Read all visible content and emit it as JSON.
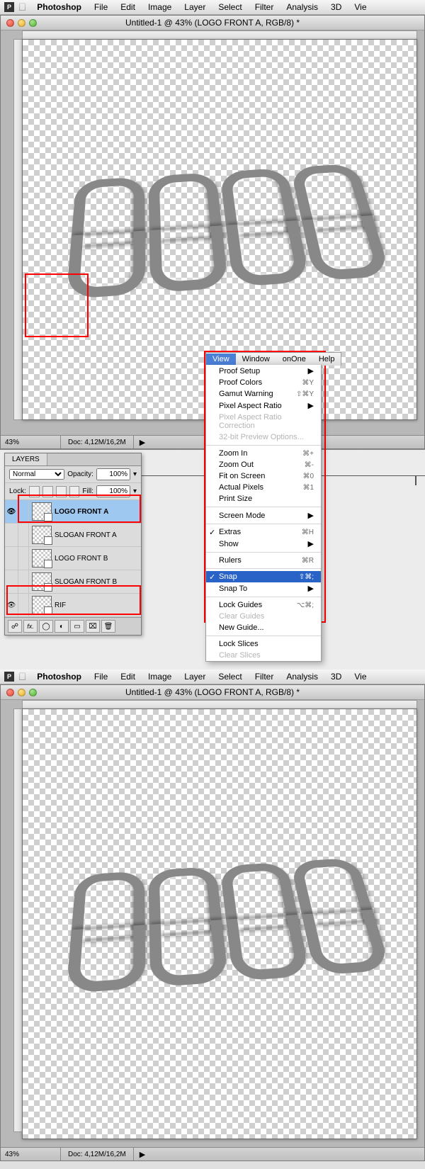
{
  "menubar": {
    "app_name": "Photoshop",
    "items": [
      "File",
      "Edit",
      "Image",
      "Layer",
      "Select",
      "Filter",
      "Analysis",
      "3D",
      "Vie"
    ]
  },
  "window": {
    "title": "Untitled-1 @ 43% (LOGO FRONT A, RGB/8) *"
  },
  "statusbar": {
    "zoom": "43%",
    "doc": "Doc: 4,12M/16,2M"
  },
  "layers_panel": {
    "tab": "LAYERS",
    "blend_mode": "Normal",
    "opacity_label": "Opacity:",
    "opacity_value": "100%",
    "lock_label": "Lock:",
    "fill_label": "Fill:",
    "fill_value": "100%",
    "layers": [
      {
        "name": "LOGO FRONT A",
        "visible": true,
        "selected": true
      },
      {
        "name": "SLOGAN FRONT A",
        "visible": false,
        "selected": false
      },
      {
        "name": "LOGO FRONT B",
        "visible": false,
        "selected": false
      },
      {
        "name": "SLOGAN FRONT B",
        "visible": false,
        "selected": false
      },
      {
        "name": "RIF",
        "visible": true,
        "selected": false
      }
    ],
    "footer_icons": [
      "☍",
      "fx.",
      "◯",
      "◐",
      "▭",
      "⌧",
      "🗑"
    ]
  },
  "menu_popup": {
    "bar": [
      "View",
      "Window",
      "onOne",
      "Help"
    ],
    "active": "View",
    "items": [
      {
        "label": "Proof Setup",
        "sub": true
      },
      {
        "label": "Proof Colors",
        "shortcut": "⌘Y"
      },
      {
        "label": "Gamut Warning",
        "shortcut": "⇧⌘Y"
      },
      {
        "label": "Pixel Aspect Ratio",
        "sub": true
      },
      {
        "label": "Pixel Aspect Ratio Correction",
        "disabled": true
      },
      {
        "label": "32-bit Preview Options...",
        "disabled": true
      },
      {
        "sep": true
      },
      {
        "label": "Zoom In",
        "shortcut": "⌘+"
      },
      {
        "label": "Zoom Out",
        "shortcut": "⌘-"
      },
      {
        "label": "Fit on Screen",
        "shortcut": "⌘0"
      },
      {
        "label": "Actual Pixels",
        "shortcut": "⌘1"
      },
      {
        "label": "Print Size"
      },
      {
        "sep": true
      },
      {
        "label": "Screen Mode",
        "sub": true
      },
      {
        "sep": true
      },
      {
        "label": "Extras",
        "shortcut": "⌘H",
        "check": true
      },
      {
        "label": "Show",
        "sub": true
      },
      {
        "sep": true
      },
      {
        "label": "Rulers",
        "shortcut": "⌘R"
      },
      {
        "sep": true
      },
      {
        "label": "Snap",
        "shortcut": "⇧⌘;",
        "check": true,
        "selected": true
      },
      {
        "label": "Snap To",
        "sub": true
      },
      {
        "sep": true
      },
      {
        "label": "Lock Guides",
        "shortcut": "⌥⌘;"
      },
      {
        "label": "Clear Guides",
        "disabled": true
      },
      {
        "label": "New Guide..."
      },
      {
        "sep": true
      },
      {
        "label": "Lock Slices"
      },
      {
        "label": "Clear Slices",
        "disabled": true
      }
    ]
  }
}
